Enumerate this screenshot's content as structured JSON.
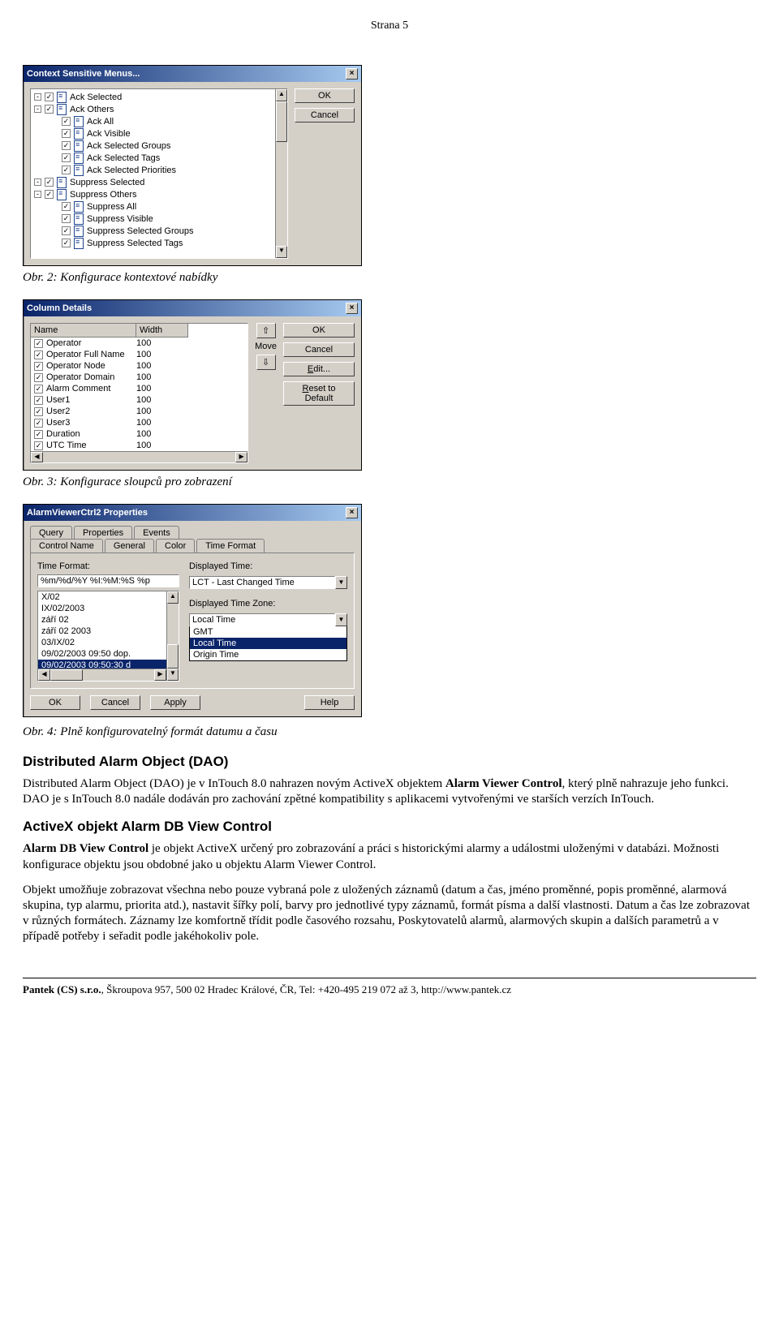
{
  "pageHeader": "Strana 5",
  "dlg1": {
    "title": "Context Sensitive Menus...",
    "items": [
      {
        "label": "Ack Selected",
        "expander": "-",
        "sub": false
      },
      {
        "label": "Ack Others",
        "expander": "-",
        "sub": false
      },
      {
        "label": "Ack All",
        "expander": "",
        "sub": true
      },
      {
        "label": "Ack Visible",
        "expander": "",
        "sub": true
      },
      {
        "label": "Ack Selected Groups",
        "expander": "",
        "sub": true
      },
      {
        "label": "Ack Selected Tags",
        "expander": "",
        "sub": true
      },
      {
        "label": "Ack Selected Priorities",
        "expander": "",
        "sub": true
      },
      {
        "label": "Suppress Selected",
        "expander": "-",
        "sub": false
      },
      {
        "label": "Suppress Others",
        "expander": "-",
        "sub": false
      },
      {
        "label": "Suppress All",
        "expander": "",
        "sub": true
      },
      {
        "label": "Suppress Visible",
        "expander": "",
        "sub": true
      },
      {
        "label": "Suppress Selected Groups",
        "expander": "",
        "sub": true
      },
      {
        "label": "Suppress Selected Tags",
        "expander": "",
        "sub": true
      }
    ],
    "ok": "OK",
    "cancel": "Cancel"
  },
  "caption1": "Obr. 2: Konfigurace kontextové nabídky",
  "dlg2": {
    "title": "Column Details",
    "headName": "Name",
    "headWidth": "Width",
    "rows": [
      {
        "name": "Operator",
        "width": "100"
      },
      {
        "name": "Operator Full Name",
        "width": "100"
      },
      {
        "name": "Operator Node",
        "width": "100"
      },
      {
        "name": "Operator Domain",
        "width": "100"
      },
      {
        "name": "Alarm Comment",
        "width": "100"
      },
      {
        "name": "User1",
        "width": "100"
      },
      {
        "name": "User2",
        "width": "100"
      },
      {
        "name": "User3",
        "width": "100"
      },
      {
        "name": "Duration",
        "width": "100"
      },
      {
        "name": "UTC Time",
        "width": "100"
      }
    ],
    "moveLabel": "Move",
    "ok": "OK",
    "cancel": "Cancel",
    "edit": "Edit...",
    "reset": "Reset to Default"
  },
  "caption2": "Obr. 3:  Konfigurace sloupců pro zobrazení",
  "dlg3": {
    "title": "AlarmViewerCtrl2 Properties",
    "tabsBack": [
      "Query",
      "Properties",
      "Events"
    ],
    "tabsFront": [
      "Control Name",
      "General",
      "Color",
      "Time Format"
    ],
    "activeTab": "Time Format",
    "timeFormatLabel": "Time Format:",
    "timeFormatValue": "%m/%d/%Y %I:%M:%S %p",
    "formatList": [
      "X/02",
      "IX/02/2003",
      "září 02",
      "září 02 2003",
      "03/IX/02",
      "09/02/2003 09:50 dop.",
      "09/02/2003 09:50:30 d"
    ],
    "dispTimeLabel": "Displayed Time:",
    "dispTimeValue": "LCT - Last Changed Time",
    "dispZoneLabel": "Displayed Time Zone:",
    "dispZoneValue": "Local Time",
    "zoneOptions": [
      "GMT",
      "Local Time",
      "Origin Time"
    ],
    "ok": "OK",
    "cancel": "Cancel",
    "apply": "Apply",
    "help": "Help"
  },
  "caption3": "Obr. 4: Plně konfigurovatelný formát  datumu a času",
  "section1": {
    "title": "Distributed Alarm Object (DAO)",
    "p1": "Distributed Alarm Object (DAO) je v InTouch 8.0 nahrazen novým ActiveX objektem Alarm Viewer Control, který plně nahrazuje jeho funkci. DAO je s InTouch 8.0 nadále dodáván pro zachování zpětné kompatibility s aplikacemi vytvořenými ve starších verzích InTouch."
  },
  "section2": {
    "title": "ActiveX objekt Alarm DB View Control",
    "p1": "Alarm DB View Control je objekt ActiveX určený pro zobrazování a práci s historickými alarmy a událostmi uloženými v databázi. Možnosti konfigurace objektu jsou obdobné jako u objektu Alarm Viewer Control.",
    "p2": "Objekt umožňuje zobrazovat všechna nebo pouze vybraná pole z uložených záznamů (datum a čas, jméno proměnné, popis proměnné, alarmová skupina, typ alarmu, priorita atd.), nastavit šířky polí, barvy pro jednotlivé typy záznamů, formát písma a další vlastnosti. Datum a čas lze zobrazovat v různých formátech. Záznamy lze komfortně třídit podle časového rozsahu, Poskytovatelů alarmů, alarmových skupin a dalších parametrů a v případě potřeby i seřadit podle jakéhokoliv pole."
  },
  "footer": "Pantek (CS) s.r.o., Škroupova 957, 500 02 Hradec Králové, ČR, Tel: +420-495 219 072 až 3, http://www.pantek.cz"
}
